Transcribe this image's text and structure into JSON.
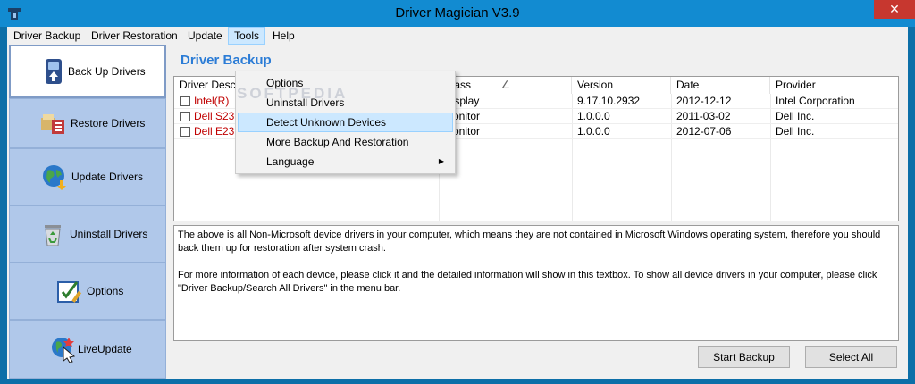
{
  "window": {
    "title": "Driver Magician V3.9",
    "close_glyph": "✕"
  },
  "menu": [
    {
      "label": "Driver Backup"
    },
    {
      "label": "Driver Restoration"
    },
    {
      "label": "Update"
    },
    {
      "label": "Tools"
    },
    {
      "label": "Help"
    }
  ],
  "tools_menu": {
    "items": [
      {
        "label": "Options"
      },
      {
        "label": "Uninstall Drivers"
      },
      {
        "label": "Detect Unknown Devices"
      },
      {
        "label": "More Backup And Restoration"
      },
      {
        "label": "Language",
        "arrow": "▶"
      }
    ]
  },
  "sidebar": {
    "items": [
      {
        "label": "Back Up Drivers",
        "icon": "backup-icon"
      },
      {
        "label": "Restore Drivers",
        "icon": "restore-icon"
      },
      {
        "label": "Update Drivers",
        "icon": "globe-update-icon"
      },
      {
        "label": "Uninstall Drivers",
        "icon": "recycle-bin-icon"
      },
      {
        "label": "Options",
        "icon": "options-icon"
      },
      {
        "label": "LiveUpdate",
        "icon": "live-update-icon"
      }
    ]
  },
  "section_title": "Driver Backup",
  "table": {
    "columns": [
      "Driver Description",
      "Class",
      "Version",
      "Date",
      "Provider"
    ],
    "sort_indicator": "∠",
    "rows": [
      {
        "description": "Intel(R)",
        "class": "Display",
        "version": "9.17.10.2932",
        "date": "2012-12-12",
        "provider": "Intel Corporation"
      },
      {
        "description": "Dell S23",
        "class": "Monitor",
        "version": "1.0.0.0",
        "date": "2011-03-02",
        "provider": "Dell Inc."
      },
      {
        "description": "Dell E23",
        "class": "Monitor",
        "version": "1.0.0.0",
        "date": "2012-07-06",
        "provider": "Dell Inc."
      }
    ]
  },
  "info_text": {
    "para1": "The above is all Non-Microsoft device drivers in your computer, which means they are not contained in Microsoft Windows operating system, therefore you should back them up for restoration after system crash.",
    "para2": "For more information of each device, please click it and the detailed information will show in this textbox. To show all device drivers in your computer, please click \"Driver Backup/Search All Drivers\" in the menu bar."
  },
  "buttons": {
    "start_backup": "Start Backup",
    "select_all": "Select All"
  },
  "watermark": "SOFTPEDIA",
  "colors": {
    "titlebar": "#128bd1",
    "sidebar": "#b0c8ea",
    "accent": "#2b7cd6",
    "driver_red": "#c00000",
    "close": "#c7372f"
  }
}
